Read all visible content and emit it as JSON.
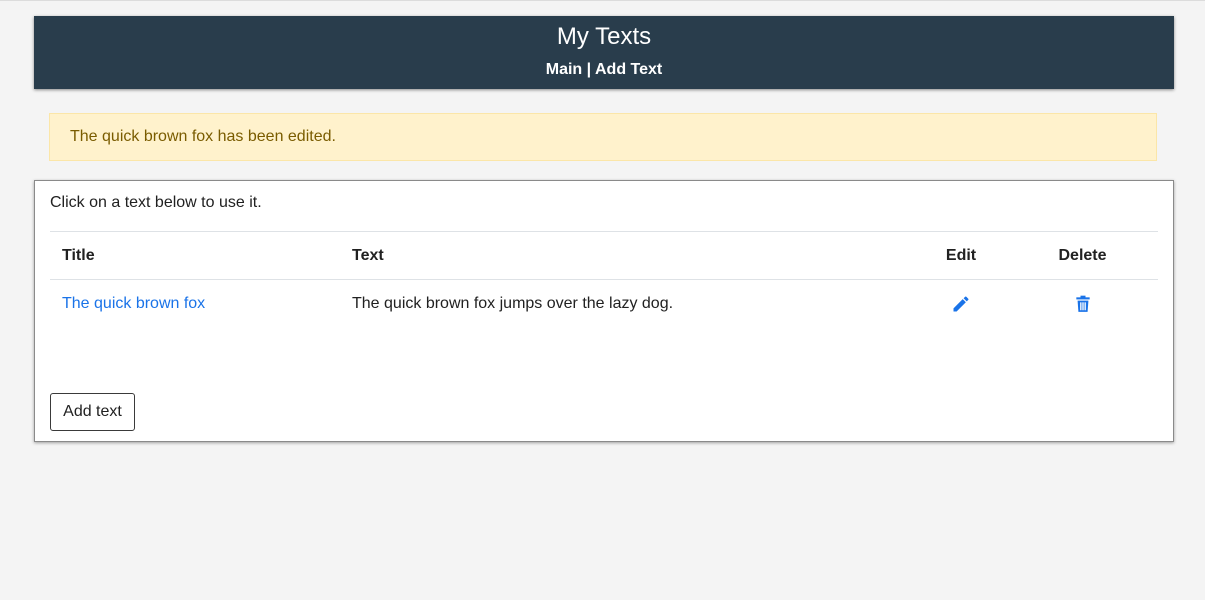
{
  "header": {
    "title": "My Texts",
    "nav": {
      "main_label": "Main",
      "separator": "|",
      "add_text_label": "Add Text"
    }
  },
  "alert": {
    "message": "The quick brown fox has been edited."
  },
  "panel": {
    "instructions": "Click on a text below to use it.",
    "table": {
      "columns": [
        "Title",
        "Text",
        "Edit",
        "Delete"
      ],
      "rows": [
        {
          "title": "The quick brown fox",
          "text": "The quick brown fox jumps over the lazy dog.",
          "edit_icon": "pencil-icon",
          "delete_icon": "trash-icon"
        }
      ]
    },
    "add_button_label": "Add text"
  },
  "colors": {
    "header_bg": "#293d4c",
    "alert_bg": "#fff2cc",
    "alert_text": "#7a5c00",
    "link": "#1a73e8",
    "page_bg": "#f4f4f4"
  }
}
